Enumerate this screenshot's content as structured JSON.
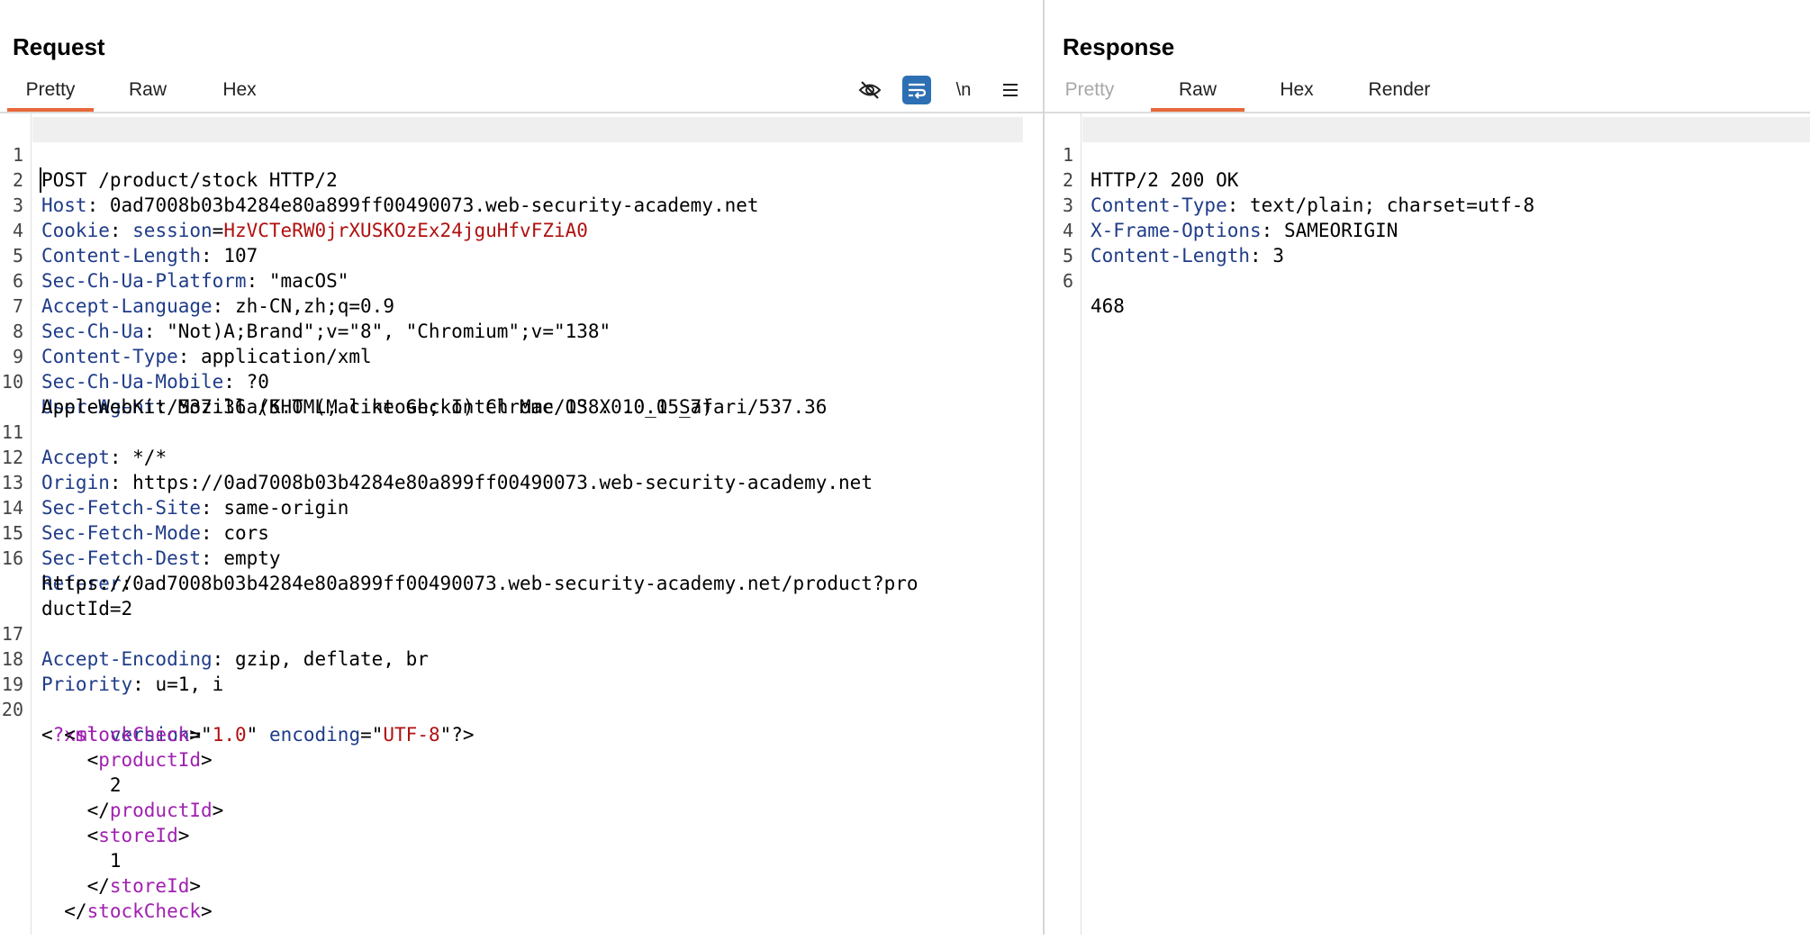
{
  "request": {
    "title": "Request",
    "tabs": [
      "Pretty",
      "Raw",
      "Hex"
    ],
    "active_tab": "Pretty",
    "toolbar_icons": [
      "hide-eye-icon",
      "word-wrap-icon",
      "newline-toggle-icon",
      "menu-icon"
    ],
    "newline_label": "\\n",
    "headers": [
      {
        "n": "1",
        "text": "POST /product/stock HTTP/2"
      },
      {
        "n": "2",
        "k": "Host",
        "v": "0ad7008b03b4284e80a899ff00490073.web-security-academy.net"
      },
      {
        "n": "3",
        "k": "Cookie",
        "ck": "session",
        "cv": "HzVCTeRW0jrXUSKOzEx24jguHfvFZiA0"
      },
      {
        "n": "4",
        "k": "Content-Length",
        "v": "107"
      },
      {
        "n": "5",
        "k": "Sec-Ch-Ua-Platform",
        "v": "\"macOS\""
      },
      {
        "n": "6",
        "k": "Accept-Language",
        "v": "zh-CN,zh;q=0.9"
      },
      {
        "n": "7",
        "k": "Sec-Ch-Ua",
        "v": "\"Not)A;Brand\";v=\"8\", \"Chromium\";v=\"138\""
      },
      {
        "n": "8",
        "k": "Content-Type",
        "v": "application/xml"
      },
      {
        "n": "9",
        "k": "Sec-Ch-Ua-Mobile",
        "v": "?0"
      },
      {
        "n": "10",
        "k": "User-Agent",
        "v": "Mozilla/5.0 (Macintosh; Intel Mac OS X 10_15_7)",
        "cont": "AppleWebKit/537.36 (KHTML, like Gecko) Chrome/138.0.0.0 Safari/537.36"
      },
      {
        "n": "11",
        "k": "Accept",
        "v": "*/*"
      },
      {
        "n": "12",
        "k": "Origin",
        "v": "https://0ad7008b03b4284e80a899ff00490073.web-security-academy.net"
      },
      {
        "n": "13",
        "k": "Sec-Fetch-Site",
        "v": "same-origin"
      },
      {
        "n": "14",
        "k": "Sec-Fetch-Mode",
        "v": "cors"
      },
      {
        "n": "15",
        "k": "Sec-Fetch-Dest",
        "v": "empty"
      },
      {
        "n": "16",
        "k": "Referer",
        "v": "",
        "cont": "https://0ad7008b03b4284e80a899ff00490073.web-security-academy.net/product?pro",
        "cont2": "ductId=2"
      },
      {
        "n": "17",
        "k": "Accept-Encoding",
        "v": "gzip, deflate, br"
      },
      {
        "n": "18",
        "k": "Priority",
        "v": "u=1, i"
      },
      {
        "n": "19",
        "text": ""
      }
    ],
    "xml": {
      "n": "20",
      "decl_version": "1.0",
      "decl_encoding": "UTF-8",
      "root": "stockCheck",
      "product_tag": "productId",
      "product_value": "2",
      "store_tag": "storeId",
      "store_value": "1"
    }
  },
  "response": {
    "title": "Response",
    "tabs": [
      "Pretty",
      "Raw",
      "Hex",
      "Render"
    ],
    "active_tab": "Raw",
    "lines": [
      {
        "n": "1",
        "text": "HTTP/2 200 OK"
      },
      {
        "n": "2",
        "k": "Content-Type",
        "v": "text/plain; charset=utf-8"
      },
      {
        "n": "3",
        "k": "X-Frame-Options",
        "v": "SAMEORIGIN"
      },
      {
        "n": "4",
        "k": "Content-Length",
        "v": "3"
      },
      {
        "n": "5",
        "text": ""
      },
      {
        "n": "6",
        "text": "468"
      }
    ]
  }
}
